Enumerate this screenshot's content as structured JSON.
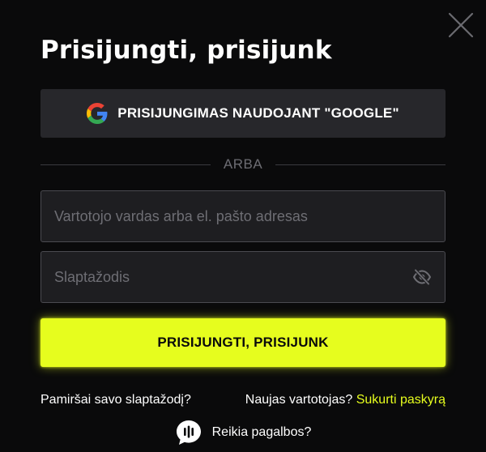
{
  "modal": {
    "title": "Prisijungti, prisijunk",
    "close_icon": "close-icon"
  },
  "google": {
    "label": "PRISIJUNGIMAS NAUDOJANT \"GOOGLE\"",
    "icon": "google-icon"
  },
  "divider": {
    "text": "ARBA"
  },
  "form": {
    "username_placeholder": "Vartotojo vardas arba el. pašto adresas",
    "username_value": "",
    "password_placeholder": "Slaptažodis",
    "password_value": "",
    "password_toggle_icon": "eye-slash-icon",
    "submit_label": "PRISIJUNGTI, PRISIJUNK"
  },
  "links": {
    "forgot_password": "Pamiršai savo slaptažodį?",
    "new_user_text": "Naujas vartotojas?",
    "create_account": "Sukurti paskyrą"
  },
  "help": {
    "label": "Reikia pagalbos?",
    "icon": "chat-bubble-icon"
  },
  "colors": {
    "background": "#0a0a0b",
    "panel": "#27272b",
    "input_bg": "#1e1e21",
    "accent": "#e6fd1e",
    "muted_text": "#6e6e74"
  }
}
